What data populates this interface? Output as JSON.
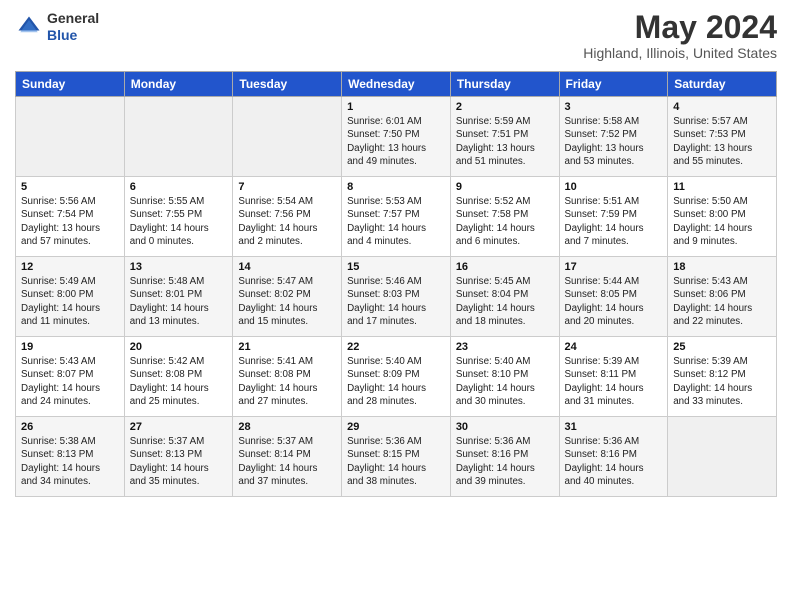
{
  "header": {
    "logo_general": "General",
    "logo_blue": "Blue",
    "month_title": "May 2024",
    "location": "Highland, Illinois, United States"
  },
  "weekdays": [
    "Sunday",
    "Monday",
    "Tuesday",
    "Wednesday",
    "Thursday",
    "Friday",
    "Saturday"
  ],
  "weeks": [
    [
      {
        "day": "",
        "sunrise": "",
        "sunset": "",
        "daylight": ""
      },
      {
        "day": "",
        "sunrise": "",
        "sunset": "",
        "daylight": ""
      },
      {
        "day": "",
        "sunrise": "",
        "sunset": "",
        "daylight": ""
      },
      {
        "day": "1",
        "sunrise": "Sunrise: 6:01 AM",
        "sunset": "Sunset: 7:50 PM",
        "daylight": "Daylight: 13 hours and 49 minutes."
      },
      {
        "day": "2",
        "sunrise": "Sunrise: 5:59 AM",
        "sunset": "Sunset: 7:51 PM",
        "daylight": "Daylight: 13 hours and 51 minutes."
      },
      {
        "day": "3",
        "sunrise": "Sunrise: 5:58 AM",
        "sunset": "Sunset: 7:52 PM",
        "daylight": "Daylight: 13 hours and 53 minutes."
      },
      {
        "day": "4",
        "sunrise": "Sunrise: 5:57 AM",
        "sunset": "Sunset: 7:53 PM",
        "daylight": "Daylight: 13 hours and 55 minutes."
      }
    ],
    [
      {
        "day": "5",
        "sunrise": "Sunrise: 5:56 AM",
        "sunset": "Sunset: 7:54 PM",
        "daylight": "Daylight: 13 hours and 57 minutes."
      },
      {
        "day": "6",
        "sunrise": "Sunrise: 5:55 AM",
        "sunset": "Sunset: 7:55 PM",
        "daylight": "Daylight: 14 hours and 0 minutes."
      },
      {
        "day": "7",
        "sunrise": "Sunrise: 5:54 AM",
        "sunset": "Sunset: 7:56 PM",
        "daylight": "Daylight: 14 hours and 2 minutes."
      },
      {
        "day": "8",
        "sunrise": "Sunrise: 5:53 AM",
        "sunset": "Sunset: 7:57 PM",
        "daylight": "Daylight: 14 hours and 4 minutes."
      },
      {
        "day": "9",
        "sunrise": "Sunrise: 5:52 AM",
        "sunset": "Sunset: 7:58 PM",
        "daylight": "Daylight: 14 hours and 6 minutes."
      },
      {
        "day": "10",
        "sunrise": "Sunrise: 5:51 AM",
        "sunset": "Sunset: 7:59 PM",
        "daylight": "Daylight: 14 hours and 7 minutes."
      },
      {
        "day": "11",
        "sunrise": "Sunrise: 5:50 AM",
        "sunset": "Sunset: 8:00 PM",
        "daylight": "Daylight: 14 hours and 9 minutes."
      }
    ],
    [
      {
        "day": "12",
        "sunrise": "Sunrise: 5:49 AM",
        "sunset": "Sunset: 8:00 PM",
        "daylight": "Daylight: 14 hours and 11 minutes."
      },
      {
        "day": "13",
        "sunrise": "Sunrise: 5:48 AM",
        "sunset": "Sunset: 8:01 PM",
        "daylight": "Daylight: 14 hours and 13 minutes."
      },
      {
        "day": "14",
        "sunrise": "Sunrise: 5:47 AM",
        "sunset": "Sunset: 8:02 PM",
        "daylight": "Daylight: 14 hours and 15 minutes."
      },
      {
        "day": "15",
        "sunrise": "Sunrise: 5:46 AM",
        "sunset": "Sunset: 8:03 PM",
        "daylight": "Daylight: 14 hours and 17 minutes."
      },
      {
        "day": "16",
        "sunrise": "Sunrise: 5:45 AM",
        "sunset": "Sunset: 8:04 PM",
        "daylight": "Daylight: 14 hours and 18 minutes."
      },
      {
        "day": "17",
        "sunrise": "Sunrise: 5:44 AM",
        "sunset": "Sunset: 8:05 PM",
        "daylight": "Daylight: 14 hours and 20 minutes."
      },
      {
        "day": "18",
        "sunrise": "Sunrise: 5:43 AM",
        "sunset": "Sunset: 8:06 PM",
        "daylight": "Daylight: 14 hours and 22 minutes."
      }
    ],
    [
      {
        "day": "19",
        "sunrise": "Sunrise: 5:43 AM",
        "sunset": "Sunset: 8:07 PM",
        "daylight": "Daylight: 14 hours and 24 minutes."
      },
      {
        "day": "20",
        "sunrise": "Sunrise: 5:42 AM",
        "sunset": "Sunset: 8:08 PM",
        "daylight": "Daylight: 14 hours and 25 minutes."
      },
      {
        "day": "21",
        "sunrise": "Sunrise: 5:41 AM",
        "sunset": "Sunset: 8:08 PM",
        "daylight": "Daylight: 14 hours and 27 minutes."
      },
      {
        "day": "22",
        "sunrise": "Sunrise: 5:40 AM",
        "sunset": "Sunset: 8:09 PM",
        "daylight": "Daylight: 14 hours and 28 minutes."
      },
      {
        "day": "23",
        "sunrise": "Sunrise: 5:40 AM",
        "sunset": "Sunset: 8:10 PM",
        "daylight": "Daylight: 14 hours and 30 minutes."
      },
      {
        "day": "24",
        "sunrise": "Sunrise: 5:39 AM",
        "sunset": "Sunset: 8:11 PM",
        "daylight": "Daylight: 14 hours and 31 minutes."
      },
      {
        "day": "25",
        "sunrise": "Sunrise: 5:39 AM",
        "sunset": "Sunset: 8:12 PM",
        "daylight": "Daylight: 14 hours and 33 minutes."
      }
    ],
    [
      {
        "day": "26",
        "sunrise": "Sunrise: 5:38 AM",
        "sunset": "Sunset: 8:13 PM",
        "daylight": "Daylight: 14 hours and 34 minutes."
      },
      {
        "day": "27",
        "sunrise": "Sunrise: 5:37 AM",
        "sunset": "Sunset: 8:13 PM",
        "daylight": "Daylight: 14 hours and 35 minutes."
      },
      {
        "day": "28",
        "sunrise": "Sunrise: 5:37 AM",
        "sunset": "Sunset: 8:14 PM",
        "daylight": "Daylight: 14 hours and 37 minutes."
      },
      {
        "day": "29",
        "sunrise": "Sunrise: 5:36 AM",
        "sunset": "Sunset: 8:15 PM",
        "daylight": "Daylight: 14 hours and 38 minutes."
      },
      {
        "day": "30",
        "sunrise": "Sunrise: 5:36 AM",
        "sunset": "Sunset: 8:16 PM",
        "daylight": "Daylight: 14 hours and 39 minutes."
      },
      {
        "day": "31",
        "sunrise": "Sunrise: 5:36 AM",
        "sunset": "Sunset: 8:16 PM",
        "daylight": "Daylight: 14 hours and 40 minutes."
      },
      {
        "day": "",
        "sunrise": "",
        "sunset": "",
        "daylight": ""
      }
    ]
  ]
}
